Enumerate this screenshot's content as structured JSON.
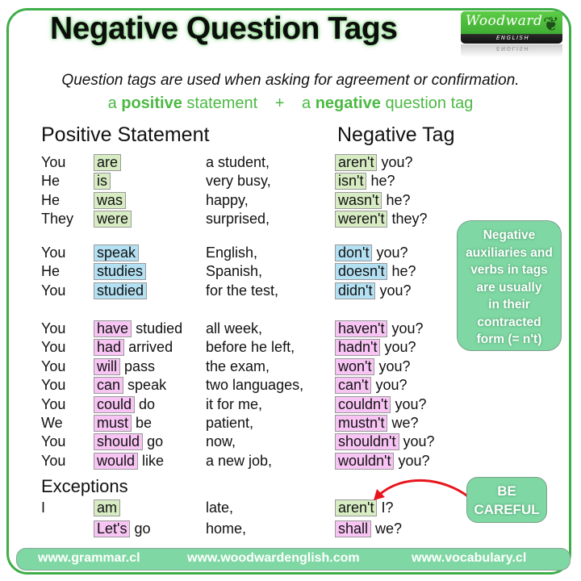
{
  "title": "Negative Question Tags",
  "logo": {
    "brand": "Woodward",
    "sub": "ENGLISH"
  },
  "subtitle": "Question tags are used when asking for agreement or confirmation.",
  "formula": {
    "a1": "a",
    "positive": "positive",
    "statement": "statement",
    "plus": "+",
    "a2": "a",
    "negative": "negative",
    "question_tag": "question tag"
  },
  "headers": {
    "positive": "Positive Statement",
    "negative": "Negative Tag",
    "exceptions": "Exceptions"
  },
  "colors": {
    "green_hl": "#d7ecc3",
    "blue_hl": "#b3e0f2",
    "pink_hl": "#f8c4f4",
    "brand_green": "#4cb944",
    "note_bg": "#7fd8a3",
    "arrow": "#e8141b"
  },
  "rows": [
    {
      "subject": "You",
      "aux": "are",
      "verb": "",
      "rest": "a student,",
      "tag": "aren't",
      "tag_rest": "you?",
      "color": "g"
    },
    {
      "subject": "He",
      "aux": "is",
      "verb": "",
      "rest": "very busy,",
      "tag": "isn't",
      "tag_rest": "he?",
      "color": "g"
    },
    {
      "subject": "He",
      "aux": "was",
      "verb": "",
      "rest": "happy,",
      "tag": "wasn't",
      "tag_rest": "he?",
      "color": "g"
    },
    {
      "subject": "They",
      "aux": "were",
      "verb": "",
      "rest": "surprised,",
      "tag": "weren't",
      "tag_rest": "they?",
      "color": "g"
    },
    {
      "subject": "You",
      "aux": "speak",
      "verb": "",
      "rest": "English,",
      "tag": "don't",
      "tag_rest": "you?",
      "color": "b"
    },
    {
      "subject": "He",
      "aux": "studies",
      "verb": "",
      "rest": "Spanish,",
      "tag": "doesn't",
      "tag_rest": "he?",
      "color": "b"
    },
    {
      "subject": "You",
      "aux": "studied",
      "verb": "",
      "rest": "for the test,",
      "tag": "didn't",
      "tag_rest": "you?",
      "color": "b"
    },
    {
      "subject": "You",
      "aux": "have",
      "verb": "studied",
      "rest": "all week,",
      "tag": "haven't",
      "tag_rest": "you?",
      "color": "p"
    },
    {
      "subject": "You",
      "aux": "had",
      "verb": "arrived",
      "rest": "before he left,",
      "tag": "hadn't",
      "tag_rest": "you?",
      "color": "p"
    },
    {
      "subject": "You",
      "aux": "will",
      "verb": "pass",
      "rest": "the exam,",
      "tag": "won't",
      "tag_rest": "you?",
      "color": "p"
    },
    {
      "subject": "You",
      "aux": "can",
      "verb": "speak",
      "rest": "two languages,",
      "tag": "can't",
      "tag_rest": "you?",
      "color": "p"
    },
    {
      "subject": "You",
      "aux": "could",
      "verb": "do",
      "rest": "it for me,",
      "tag": "couldn't",
      "tag_rest": "you?",
      "color": "p"
    },
    {
      "subject": "We",
      "aux": "must",
      "verb": "be",
      "rest": "patient,",
      "tag": "mustn't",
      "tag_rest": "we?",
      "color": "p"
    },
    {
      "subject": "You",
      "aux": "should",
      "verb": "go",
      "rest": "now,",
      "tag": "shouldn't",
      "tag_rest": "you?",
      "color": "p"
    },
    {
      "subject": "You",
      "aux": "would",
      "verb": "like",
      "rest": "a new job,",
      "tag": "wouldn't",
      "tag_rest": "you?",
      "color": "p"
    }
  ],
  "exceptions": [
    {
      "subject": "I",
      "aux": "am",
      "verb": "",
      "rest": "late,",
      "tag": "aren't",
      "tag_rest": "I?",
      "color": "g"
    },
    {
      "subject": "",
      "aux": "Let's",
      "verb": "go",
      "rest": "home,",
      "tag": "shall",
      "tag_rest": "we?",
      "color": "p"
    }
  ],
  "note": [
    "Negative",
    "auxiliaries and",
    "verbs in tags",
    "are usually",
    "in their",
    "contracted",
    "form (= n't)"
  ],
  "careful": [
    "BE",
    "CAREFUL"
  ],
  "footer": {
    "link1": "www.grammar.cl",
    "link2": "www.woodwardenglish.com",
    "link3": "www.vocabulary.cl"
  }
}
